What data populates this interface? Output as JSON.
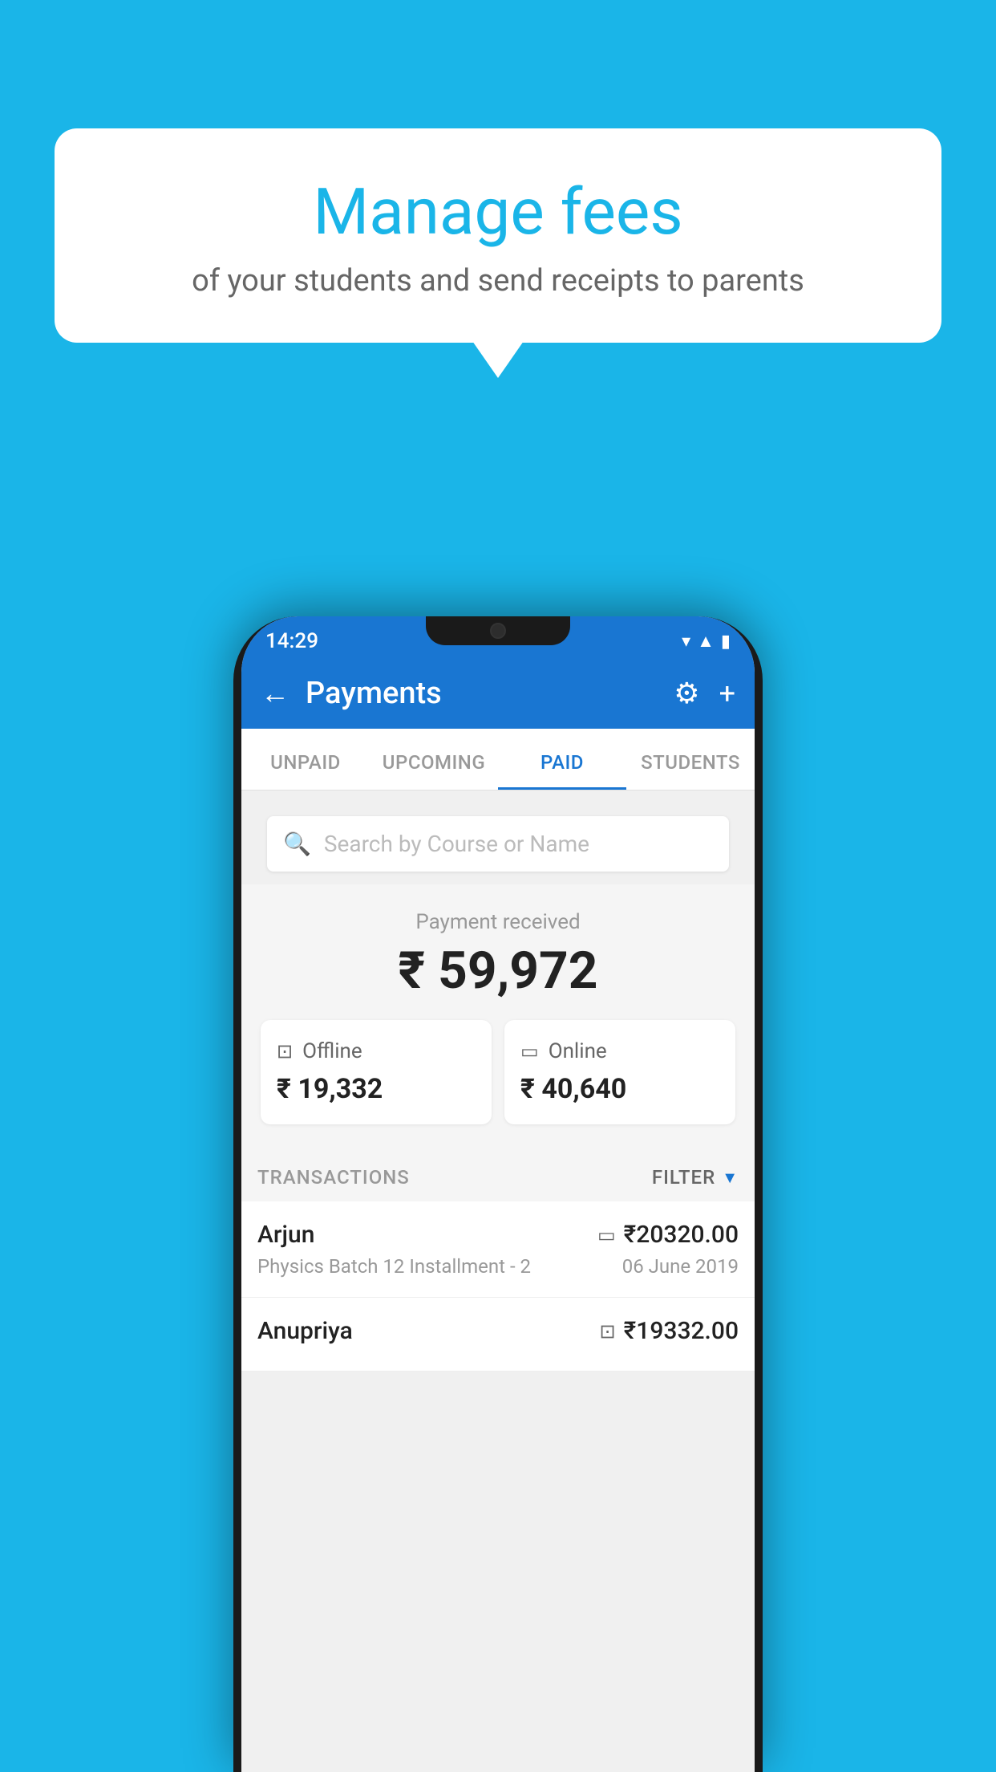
{
  "background_color": "#1ab5e8",
  "speech_bubble": {
    "title": "Manage fees",
    "subtitle": "of your students and send receipts to parents"
  },
  "status_bar": {
    "time": "14:29",
    "wifi": "▼",
    "signal": "▲",
    "battery": "▮"
  },
  "app_bar": {
    "title": "Payments",
    "back_label": "←",
    "settings_label": "⚙",
    "plus_label": "+"
  },
  "tabs": [
    {
      "label": "UNPAID",
      "active": false
    },
    {
      "label": "UPCOMING",
      "active": false
    },
    {
      "label": "PAID",
      "active": true
    },
    {
      "label": "STUDENTS",
      "active": false
    }
  ],
  "search": {
    "placeholder": "Search by Course or Name"
  },
  "payment_summary": {
    "received_label": "Payment received",
    "amount": "₹ 59,972",
    "offline": {
      "label": "Offline",
      "amount": "₹ 19,332"
    },
    "online": {
      "label": "Online",
      "amount": "₹ 40,640"
    }
  },
  "transactions": {
    "header_label": "TRANSACTIONS",
    "filter_label": "FILTER",
    "items": [
      {
        "name": "Arjun",
        "amount": "₹20320.00",
        "course": "Physics Batch 12 Installment - 2",
        "date": "06 June 2019",
        "payment_type": "online"
      },
      {
        "name": "Anupriya",
        "amount": "₹19332.00",
        "course": "",
        "date": "",
        "payment_type": "offline"
      }
    ]
  }
}
